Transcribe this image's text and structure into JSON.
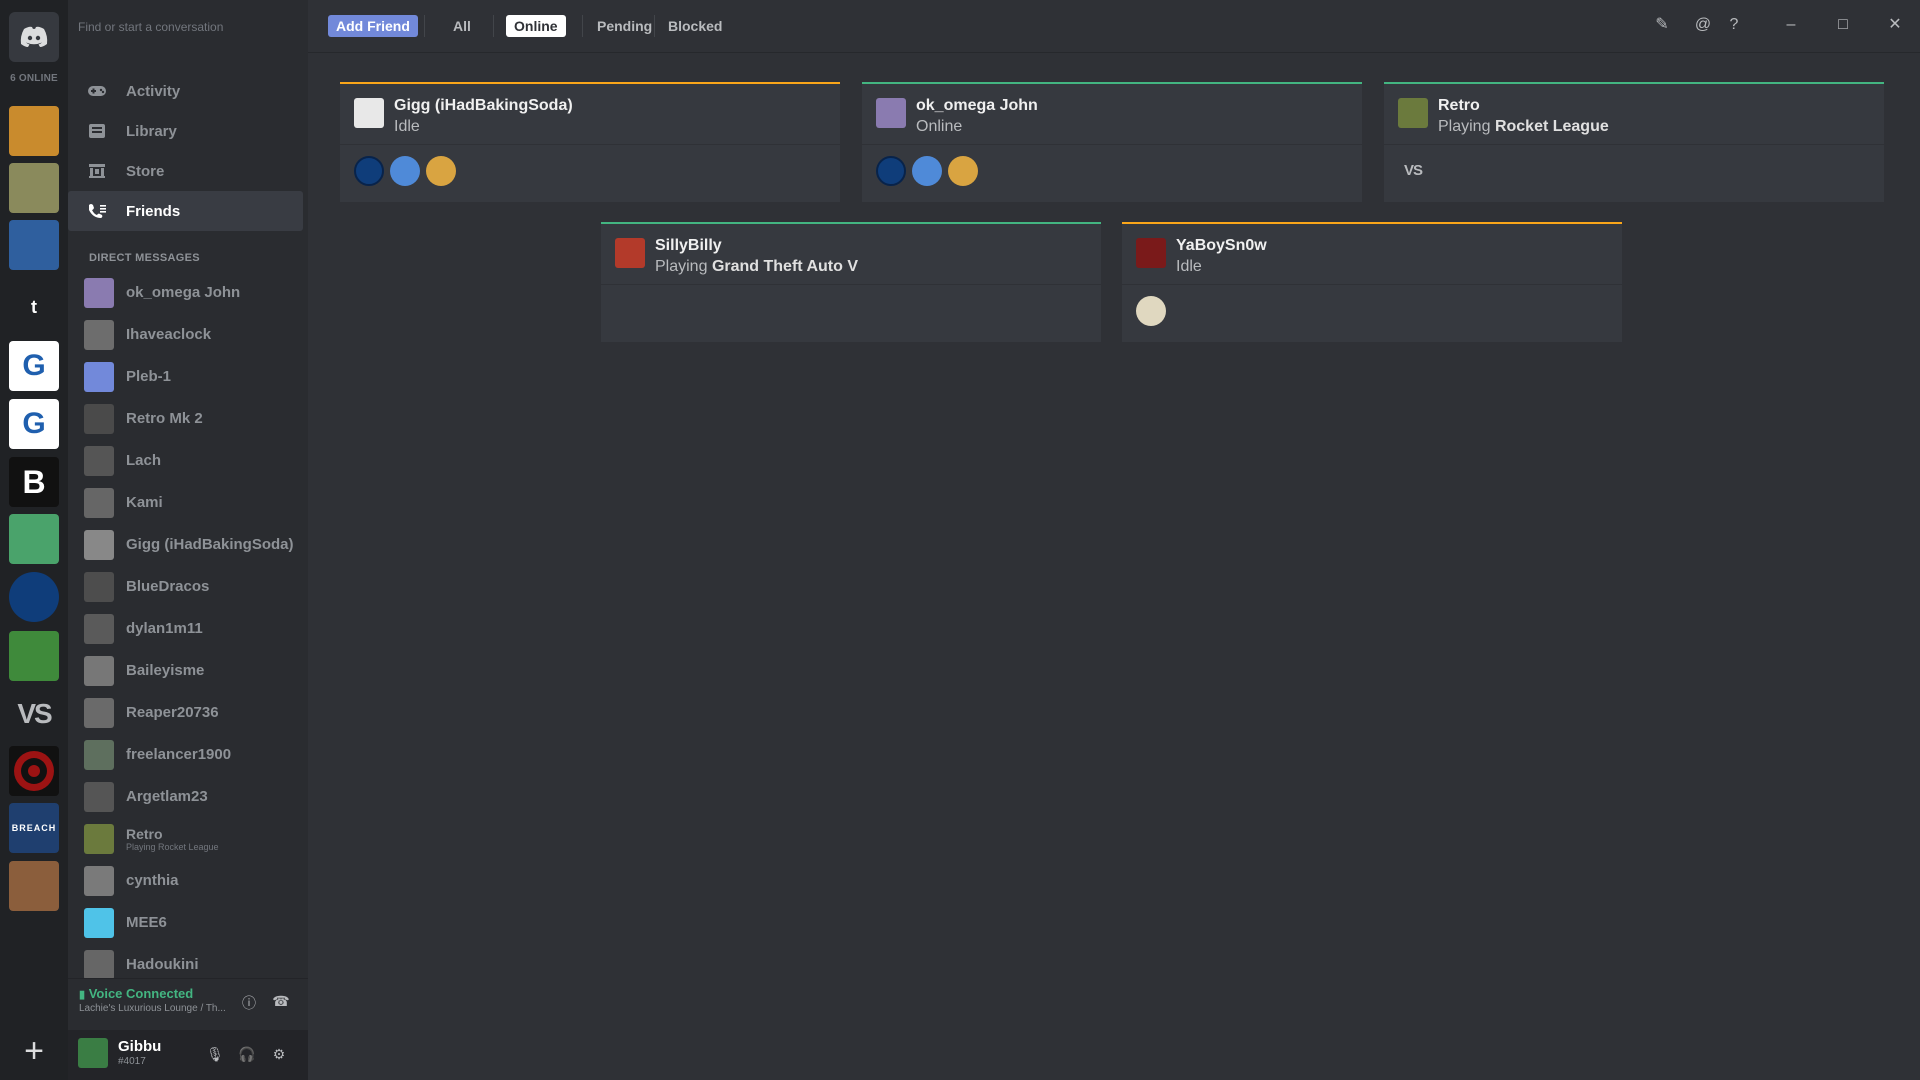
{
  "rail": {
    "online_count": "6 ONLINE",
    "servers": [
      {
        "letter": "",
        "color": "#c98b2d"
      },
      {
        "letter": "",
        "color": "#8a8a5c"
      },
      {
        "letter": "",
        "color": "#2f5f9e"
      },
      {
        "letter": "t",
        "color": "#202225"
      },
      {
        "letter": "G",
        "color": "#ffffff"
      },
      {
        "letter": "G",
        "color": "#ffffff"
      },
      {
        "letter": "B",
        "color": "#111111"
      },
      {
        "letter": "",
        "color": "#4aa36b"
      },
      {
        "letter": "",
        "color": "#0f3d7a"
      },
      {
        "letter": "",
        "color": "#3f8a3b"
      },
      {
        "letter": "VS",
        "color": "#202225"
      },
      {
        "letter": "",
        "color": "#9c1313"
      },
      {
        "letter": "BREACH",
        "color": "#1f3f6f"
      },
      {
        "letter": "",
        "color": "#8b5e3c"
      }
    ]
  },
  "sidebar": {
    "search_placeholder": "Find or start a conversation",
    "nav": [
      {
        "label": "Activity",
        "icon": "gamepad-icon"
      },
      {
        "label": "Library",
        "icon": "library-icon"
      },
      {
        "label": "Store",
        "icon": "store-icon"
      },
      {
        "label": "Friends",
        "icon": "friends-icon"
      }
    ],
    "dm_header": "DIRECT MESSAGES",
    "dms": [
      {
        "name": "ok_omega John",
        "sub": ""
      },
      {
        "name": "Ihaveaclock",
        "sub": ""
      },
      {
        "name": "Pleb-1",
        "sub": ""
      },
      {
        "name": "Retro Mk 2",
        "sub": ""
      },
      {
        "name": "Lach",
        "sub": ""
      },
      {
        "name": "Kami",
        "sub": ""
      },
      {
        "name": "Gigg (iHadBakingSoda)",
        "sub": ""
      },
      {
        "name": "BlueDracos",
        "sub": ""
      },
      {
        "name": "dylan1m11",
        "sub": ""
      },
      {
        "name": "Baileyisme",
        "sub": ""
      },
      {
        "name": "Reaper20736",
        "sub": ""
      },
      {
        "name": "freelancer1900",
        "sub": ""
      },
      {
        "name": "Argetlam23",
        "sub": ""
      },
      {
        "name": "Retro",
        "sub": "Playing Rocket League"
      },
      {
        "name": "cynthia",
        "sub": ""
      },
      {
        "name": "MEE6",
        "sub": ""
      },
      {
        "name": "Hadoukini",
        "sub": ""
      }
    ],
    "voice": {
      "status": "Voice Connected",
      "channel": "Lachie's Luxurious Lounge / Th..."
    },
    "user": {
      "name": "Gibbu",
      "discriminator": "#4017"
    }
  },
  "topbar": {
    "add_friend": "Add Friend",
    "tabs": [
      "All",
      "Online",
      "Pending",
      "Blocked"
    ]
  },
  "friends": [
    {
      "name": "Gigg (iHadBakingSoda)",
      "status": "Idle",
      "game": "",
      "status_color": "#faa61a",
      "mutuals": 3
    },
    {
      "name": "ok_omega John",
      "status": "Online",
      "game": "",
      "status_color": "#43b581",
      "mutuals": 3
    },
    {
      "name": "Retro",
      "status": "Playing",
      "game": "Rocket League",
      "status_color": "#43b581",
      "mutuals": 1
    },
    {
      "name": "SillyBilly",
      "status": "Playing",
      "game": "Grand Theft Auto V",
      "status_color": "#43b581",
      "mutuals": 0
    },
    {
      "name": "YaBoySn0w",
      "status": "Idle",
      "game": "",
      "status_color": "#faa61a",
      "mutuals": 1
    }
  ],
  "colors": {
    "accent": "#7289da",
    "online": "#43b581",
    "idle": "#faa61a"
  }
}
